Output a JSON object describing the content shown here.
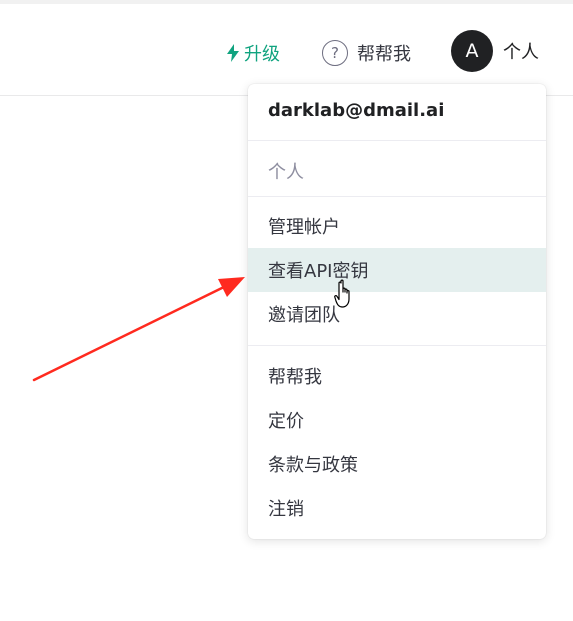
{
  "header": {
    "upgrade_label": "升级",
    "help_label": "帮帮我",
    "help_icon_glyph": "?",
    "avatar_initial": "A",
    "profile_label": "个人"
  },
  "menu": {
    "email": "darklab@dmail.ai",
    "section_label": "个人",
    "items": [
      {
        "label": "管理帐户"
      },
      {
        "label": "查看API密钥",
        "hovered": true
      },
      {
        "label": "邀请团队"
      },
      {
        "label": "帮帮我"
      },
      {
        "label": "定价"
      },
      {
        "label": "条款与政策"
      },
      {
        "label": "注销"
      }
    ]
  },
  "colors": {
    "accent": "#10a37f",
    "hover_bg": "#e4efee",
    "annotation_arrow": "#ff2a1f"
  },
  "icons": [
    "bolt-icon",
    "help-circle-icon",
    "avatar",
    "hand-pointer-icon",
    "annotation-arrow"
  ]
}
